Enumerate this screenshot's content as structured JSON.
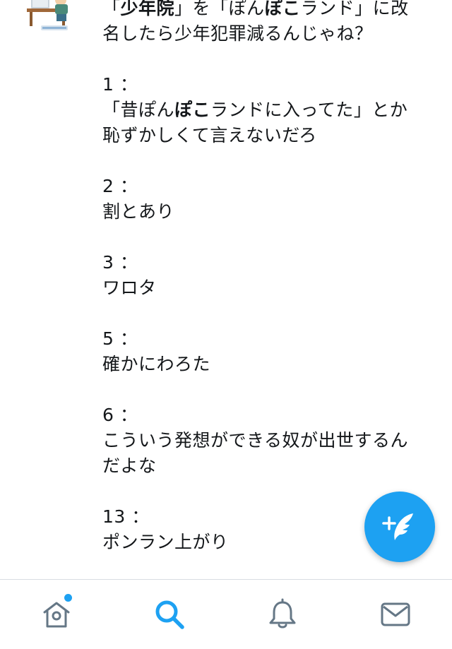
{
  "tweet": {
    "headline": {
      "q_open": "「",
      "word1": "少年院",
      "mid": "」を「ぽん",
      "word2": "ぽこ",
      "rest1": "ランド」に改",
      "line2": "名したら少年犯罪減るんじゃね？"
    },
    "replies": [
      {
        "number": "1 ：",
        "text_pre": "「昔ぽん",
        "text_bold": "ぽこ",
        "text_post": "ランドに入ってた」とか",
        "text_line2": "恥ずかしくて言えないだろ"
      },
      {
        "number": "2 ：",
        "line1": "割とあり"
      },
      {
        "number": "3 ：",
        "line1": "ワロタ"
      },
      {
        "number": "5 ：",
        "line1": "確かにわろた"
      },
      {
        "number": "6 ：",
        "line1": "こういう発想ができる奴が出世するん",
        "line2": "だよな"
      },
      {
        "number": "13 ：",
        "line1": "ポンラン上がり"
      }
    ]
  },
  "compose_button": {
    "icon": "compose-tweet-icon"
  },
  "tabbar": {
    "tabs": [
      {
        "name": "home",
        "icon": "home-icon",
        "has_notification_dot": true
      },
      {
        "name": "search",
        "icon": "search-icon",
        "active": true
      },
      {
        "name": "notifications",
        "icon": "bell-icon"
      },
      {
        "name": "messages",
        "icon": "mail-icon"
      }
    ]
  },
  "colors": {
    "accent": "#1da1f2",
    "inactive_icon": "#657786",
    "text": "#14171a",
    "divider": "#d8dde2"
  }
}
